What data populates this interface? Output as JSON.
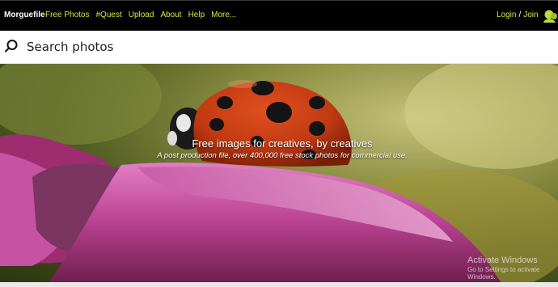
{
  "header": {
    "logo": "Morguefile",
    "nav": [
      "Free Photos",
      "#Quest",
      "Upload",
      "About",
      "Help",
      "More..."
    ],
    "login_label": "Login",
    "separator": "/",
    "join_label": "Join",
    "accent_color": "#d8e83a"
  },
  "search": {
    "placeholder": "Search photos",
    "icon": "search-icon"
  },
  "hero": {
    "title": "Free images for creatives, by creatives",
    "subtitle": "A post production file, over 400,000 free stock photos for commercial use."
  },
  "watermark": {
    "title": "Activate Windows",
    "subtitle": "Go to Settings to activate Windows."
  }
}
